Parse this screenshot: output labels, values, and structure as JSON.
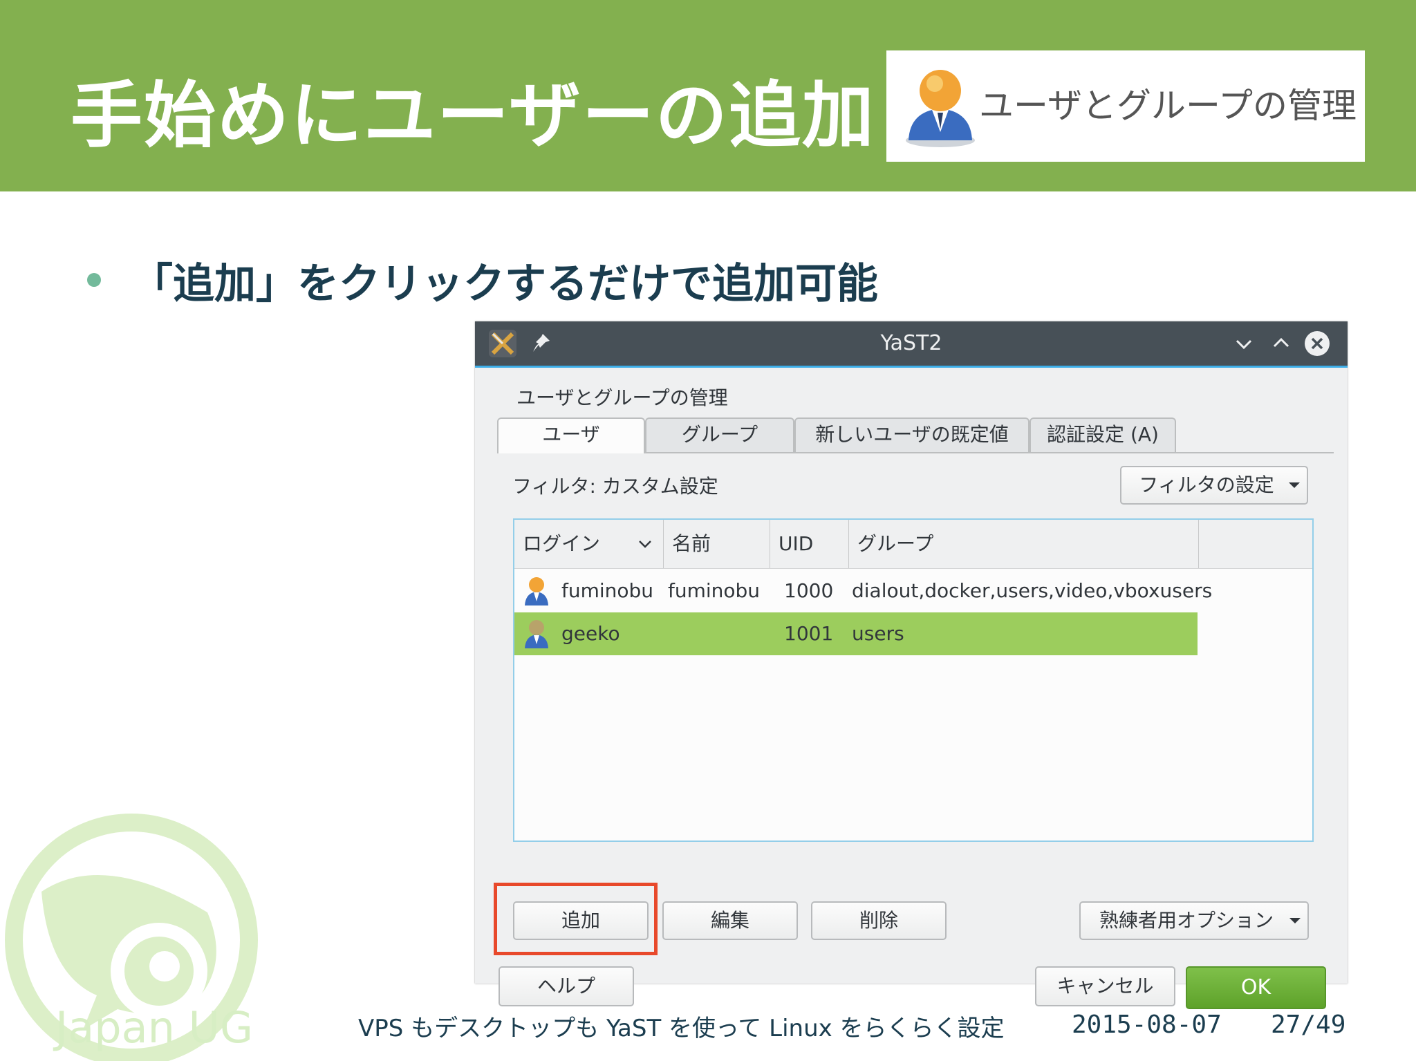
{
  "slide": {
    "title": "手始めにユーザーの追加",
    "badge_text": "ユーザとグループの管理",
    "bullet": "「追加」をクリックするだけで追加可能",
    "footer_text": "VPS もデスクトップも YaST を使って Linux をらくらく設定",
    "footer_date": "2015-08-07",
    "footer_page": "27/49",
    "logo_text": "Japan UG",
    "accent_color": "#83b04f"
  },
  "window": {
    "title": "YaST2",
    "dialog_title": "ユーザとグループの管理",
    "tabs": [
      {
        "label": "ユーザ",
        "active": true
      },
      {
        "label": "グループ",
        "active": false
      },
      {
        "label": "新しいユーザの既定値",
        "active": false
      },
      {
        "label": "認証設定 (A)",
        "active": false
      }
    ],
    "filter_label": "フィルタ: カスタム設定",
    "filter_button": "フィルタの設定",
    "table": {
      "headers": [
        "ログイン",
        "名前",
        "UID",
        "グループ"
      ],
      "rows": [
        {
          "login": "fuminobu",
          "name": "fuminobu",
          "uid": "1000",
          "groups": "dialout,docker,users,video,vboxusers",
          "selected": false
        },
        {
          "login": "geeko",
          "name": "",
          "uid": "1001",
          "groups": "users",
          "selected": true
        }
      ],
      "selection_color": "#9ccd5d"
    },
    "buttons": {
      "add": "追加",
      "edit": "編集",
      "delete": "削除",
      "expert": "熟練者用オプション",
      "help": "ヘルプ",
      "cancel": "キャンセル",
      "ok": "OK"
    },
    "highlight_color": "#e8492b"
  }
}
